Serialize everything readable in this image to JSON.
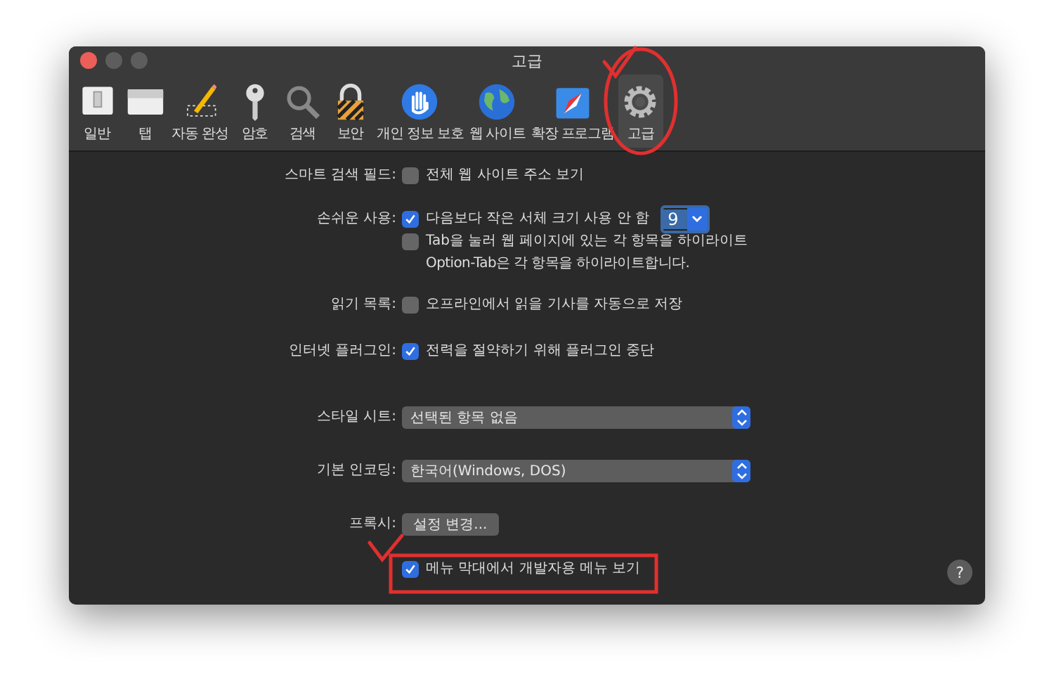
{
  "window": {
    "title": "고급"
  },
  "toolbar": {
    "items": [
      {
        "label": "일반",
        "selected": false
      },
      {
        "label": "탭",
        "selected": false
      },
      {
        "label": "자동 완성",
        "selected": false
      },
      {
        "label": "암호",
        "selected": false
      },
      {
        "label": "검색",
        "selected": false
      },
      {
        "label": "보안",
        "selected": false
      },
      {
        "label": "개인 정보 보호",
        "selected": false
      },
      {
        "label": "웹 사이트",
        "selected": false
      },
      {
        "label": "확장 프로그램",
        "selected": false
      },
      {
        "label": "고급",
        "selected": true
      }
    ]
  },
  "settings": [
    {
      "label": "스마트 검색 필드:",
      "controls": [
        {
          "kind": "checkbox",
          "text": "전체 웹 사이트 주소 보기",
          "checked": false
        }
      ]
    },
    {
      "label": "손쉬운 사용:",
      "controls": [
        {
          "kind": "checkbox",
          "text": "다음보다 작은 서체 크기 사용 안 함",
          "checked": true,
          "size": "9"
        },
        {
          "kind": "checkbox",
          "text": "Tab을 눌러 웹 페이지에 있는 각 항목을 하이라이트",
          "checked": false
        },
        {
          "kind": "note",
          "text": "Option-Tab은 각 항목을 하이라이트합니다."
        }
      ]
    },
    {
      "label": "읽기 목록:",
      "controls": [
        {
          "kind": "checkbox",
          "text": "오프라인에서 읽을 기사를 자동으로 저장",
          "checked": false
        }
      ]
    },
    {
      "label": "인터넷 플러그인:",
      "controls": [
        {
          "kind": "checkbox",
          "text": "전력을 절약하기 위해 플러그인 중단",
          "checked": true
        }
      ]
    },
    {
      "label": "스타일 시트:",
      "controls": [
        {
          "kind": "popup",
          "value": "선택된 항목 없음"
        }
      ]
    },
    {
      "label": "기본 인코딩:",
      "controls": [
        {
          "kind": "popup",
          "value": "한국어(Windows, DOS)"
        }
      ]
    },
    {
      "label": "프록시:",
      "controls": [
        {
          "kind": "button",
          "text": "설정 변경..."
        }
      ]
    },
    {
      "controls": [
        {
          "kind": "checkbox",
          "text": "메뉴 막대에서 개발자용 메뉴 보기",
          "checked": true
        }
      ]
    }
  ],
  "help": "?"
}
